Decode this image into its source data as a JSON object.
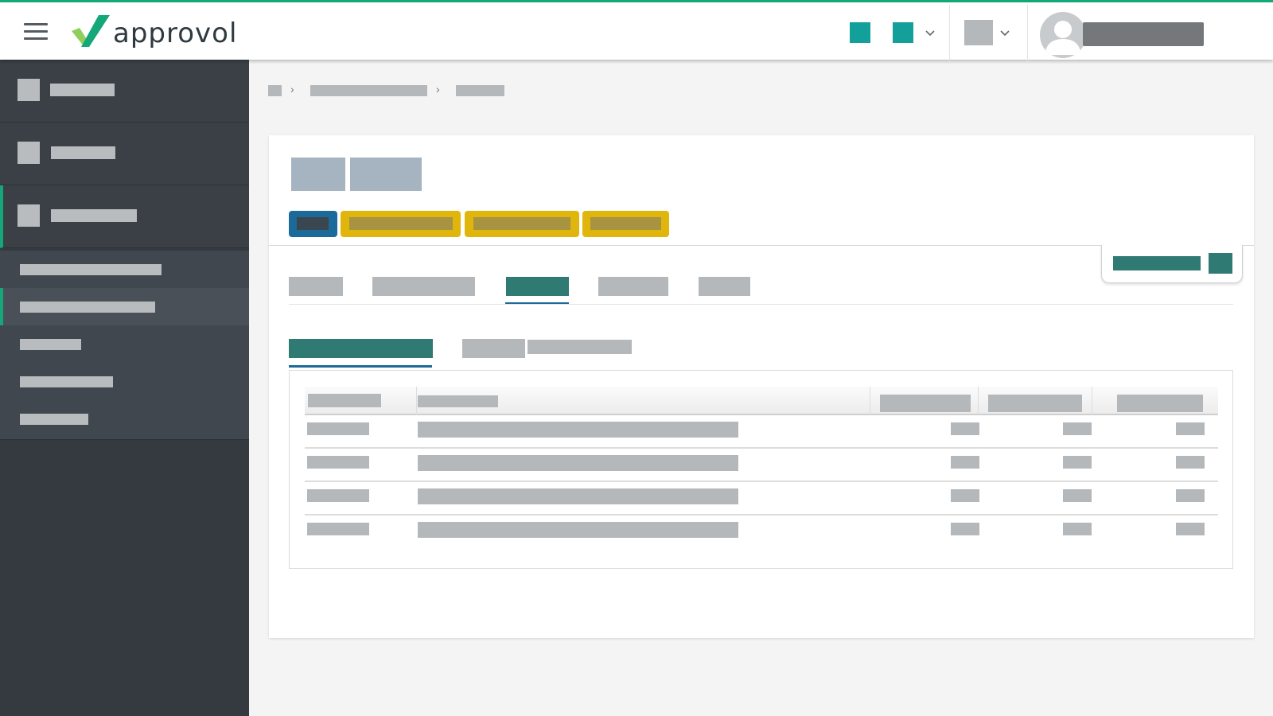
{
  "app": {
    "brand": "approvol",
    "colors": {
      "accent": "#14a77a",
      "teal": "#14a09a",
      "dark_teal": "#2f7a72",
      "sidebar_bg": "#343a40",
      "badge_blue": "#1b6a9a",
      "badge_yellow": "#e1b60c",
      "placeholder": "#b4b8bb"
    }
  },
  "topbar": {
    "menu_icon": "hamburger-menu-icon",
    "controls": [
      "teal-square-icon",
      "teal-square-icon",
      "chevron-down-icon",
      "grey-square-icon",
      "chevron-down-icon"
    ],
    "user": {
      "avatar_icon": "user-avatar-icon"
    }
  },
  "sidebar": {
    "items": [
      {
        "icon": "menu-item-icon",
        "active": false
      },
      {
        "icon": "menu-item-icon",
        "active": false
      },
      {
        "icon": "menu-item-icon",
        "active": true
      }
    ],
    "submenu": [
      {
        "active": false
      },
      {
        "active": true
      },
      {
        "active": false
      },
      {
        "active": false
      },
      {
        "active": false
      }
    ]
  },
  "breadcrumb": {
    "separator": "›"
  },
  "record": {
    "status_badges": [
      "blue",
      "yellow",
      "yellow",
      "yellow"
    ]
  },
  "tabs": {
    "count": 5,
    "active_index": 2
  },
  "subtabs": {
    "count": 2,
    "active_index": 0
  },
  "table": {
    "columns": 5,
    "rows": 4
  }
}
